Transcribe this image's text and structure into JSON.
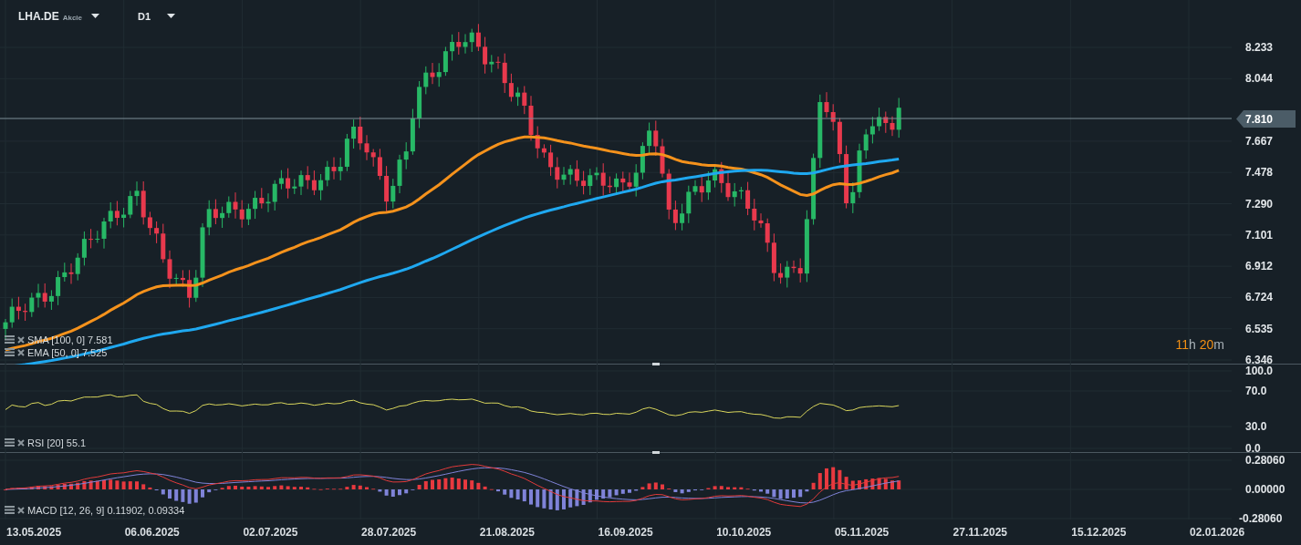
{
  "header": {
    "symbol": "LHA.DE",
    "instrument_type": "Akcie",
    "timeframe": "D1"
  },
  "price_panel": {
    "y_ticks": [
      "8.233",
      "8.044",
      "7.667",
      "7.478",
      "7.290",
      "7.101",
      "6.912",
      "6.724",
      "6.535",
      "6.346"
    ],
    "current_price": "7.810",
    "countdown": {
      "hours": "11",
      "hours_unit": "h",
      "minutes": "20",
      "minutes_unit": "m"
    },
    "legend": [
      {
        "text": "SMA [100, 0] 7.581",
        "color": "#1fa8f0"
      },
      {
        "text": "EMA [50, 0] 7.525",
        "color": "#f5921c"
      }
    ]
  },
  "rsi_panel": {
    "y_ticks": [
      "100.0",
      "70.0",
      "30.0",
      "0.0"
    ],
    "legend": "RSI [20] 55.1"
  },
  "macd_panel": {
    "y_ticks": [
      "0.28060",
      "0.00000",
      "-0.28060"
    ],
    "legend": "MACD [12, 26, 9] 0.11902, 0.09334"
  },
  "x_axis": {
    "dates": [
      "13.05.2025",
      "06.06.2025",
      "02.07.2025",
      "28.07.2025",
      "21.08.2025",
      "16.09.2025",
      "10.10.2025",
      "05.11.2025",
      "27.11.2025",
      "15.12.2025",
      "02.01.2026"
    ]
  }
}
